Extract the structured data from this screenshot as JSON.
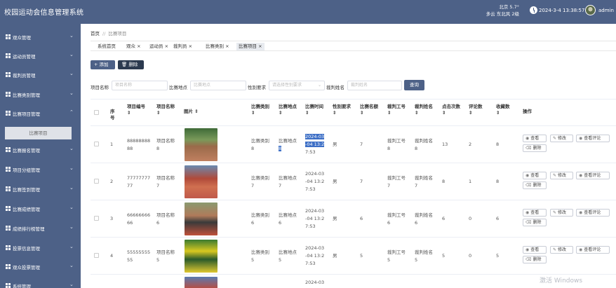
{
  "header": {
    "app_title": "校园运动会信息管理系统",
    "weather_line1": "北京  5.7°",
    "weather_line2": "多云  东北风  2级",
    "datetime": "2024-3-4 13:38:57",
    "username": "admin"
  },
  "sidebar": {
    "items": [
      {
        "label": "观众管理"
      },
      {
        "label": "运动员管理"
      },
      {
        "label": "裁判员管理"
      },
      {
        "label": "比赛类别管理"
      },
      {
        "label": "比赛项目管理"
      },
      {
        "label": "比赛报名管理"
      },
      {
        "label": "项目分组管理"
      },
      {
        "label": "比赛签到管理"
      },
      {
        "label": "比赛成绩管理"
      },
      {
        "label": "成绩排行榜管理"
      },
      {
        "label": "投票信息管理"
      },
      {
        "label": "观众投票管理"
      },
      {
        "label": "系统管理"
      }
    ],
    "active_sub": "比赛项目"
  },
  "breadcrumb": {
    "home": "首页",
    "current": "比赛项目"
  },
  "tabs": [
    {
      "label": "系统首页"
    },
    {
      "label": "观众 ×"
    },
    {
      "label": "运动员 ×"
    },
    {
      "label": "裁判员 ×"
    },
    {
      "label": "比赛类别 ×"
    },
    {
      "label": "比赛项目 ×"
    }
  ],
  "toolbar": {
    "add_label": "+ 添加",
    "delete_label": "删除"
  },
  "filters": {
    "name_label": "项目名称",
    "name_placeholder": "项目名称",
    "place_label": "比赛地点",
    "place_placeholder": "比赛地点",
    "gender_label": "性别要求",
    "gender_placeholder": "请选择性别要求",
    "referee_label": "裁判姓名",
    "referee_placeholder": "裁判姓名",
    "query_label": "查询"
  },
  "table": {
    "headers": {
      "index": "序号",
      "code": "项目编号",
      "name": "项目名称",
      "image": "图片",
      "category": "比赛类别",
      "place": "比赛地点",
      "time": "比赛时间",
      "gender": "性别要求",
      "quota": "比赛名额",
      "ref_id": "裁判工号",
      "ref_name": "裁判姓名",
      "clicks": "点击次数",
      "comments": "评论数",
      "favorites": "收藏数",
      "actions": "操作"
    },
    "rows": [
      {
        "index": "1",
        "code_a": "88888888",
        "code_b": "88",
        "name_a": "项目名称",
        "name_b": "8",
        "cat_a": "比赛类别",
        "cat_b": "8",
        "place_a": "比赛地点",
        "place_b": "8",
        "time_a": "2024-03",
        "time_b": "-04 13:2",
        "time_c": "7:53",
        "gender": "男",
        "quota": "7",
        "refid_a": "裁判工号",
        "refid_b": "8",
        "refname_a": "裁判姓名",
        "refname_b": "8",
        "clicks": "13",
        "comments": "2",
        "favorites": "8"
      },
      {
        "index": "2",
        "code_a": "77777777",
        "code_b": "77",
        "name_a": "项目名称",
        "name_b": "7",
        "cat_a": "比赛类别",
        "cat_b": "7",
        "place_a": "比赛地点",
        "place_b": "7",
        "time_a": "2024-03",
        "time_b": "-04 13:2",
        "time_c": "7:53",
        "gender": "男",
        "quota": "7",
        "refid_a": "裁判工号",
        "refid_b": "7",
        "refname_a": "裁判姓名",
        "refname_b": "7",
        "clicks": "8",
        "comments": "1",
        "favorites": "8"
      },
      {
        "index": "3",
        "code_a": "66666666",
        "code_b": "66",
        "name_a": "项目名称",
        "name_b": "6",
        "cat_a": "比赛类别",
        "cat_b": "6",
        "place_a": "比赛地点",
        "place_b": "6",
        "time_a": "2024-03",
        "time_b": "-04 13:2",
        "time_c": "7:53",
        "gender": "男",
        "quota": "6",
        "refid_a": "裁判工号",
        "refid_b": "6",
        "refname_a": "裁判姓名",
        "refname_b": "6",
        "clicks": "6",
        "comments": "0",
        "favorites": "6"
      },
      {
        "index": "4",
        "code_a": "55555555",
        "code_b": "55",
        "name_a": "项目名称",
        "name_b": "5",
        "cat_a": "比赛类别",
        "cat_b": "5",
        "place_a": "比赛地点",
        "place_b": "5",
        "time_a": "2024-03",
        "time_b": "-04 13:2",
        "time_c": "7:53",
        "gender": "男",
        "quota": "5",
        "refid_a": "裁判工号",
        "refid_b": "5",
        "refname_a": "裁判姓名",
        "refname_b": "5",
        "clicks": "5",
        "comments": "0",
        "favorites": "5"
      },
      {
        "index": "",
        "code_a": "",
        "code_b": "",
        "name_a": "",
        "name_b": "",
        "cat_a": "",
        "cat_b": "",
        "place_a": "",
        "place_b": "",
        "time_a": "2024-03",
        "time_b": "",
        "time_c": "",
        "gender": "",
        "quota": "",
        "refid_a": "",
        "refid_b": "",
        "refname_a": "",
        "refname_b": "",
        "clicks": "",
        "comments": "",
        "favorites": ""
      }
    ],
    "action_labels": {
      "view": "查看",
      "edit": "修改",
      "comments": "查看评论",
      "delete": "删除"
    }
  },
  "watermark": "激活 Windows",
  "colors": {
    "primary": "#4d6187",
    "dark": "#2c3a4f",
    "highlight": "#3d6fc6"
  }
}
